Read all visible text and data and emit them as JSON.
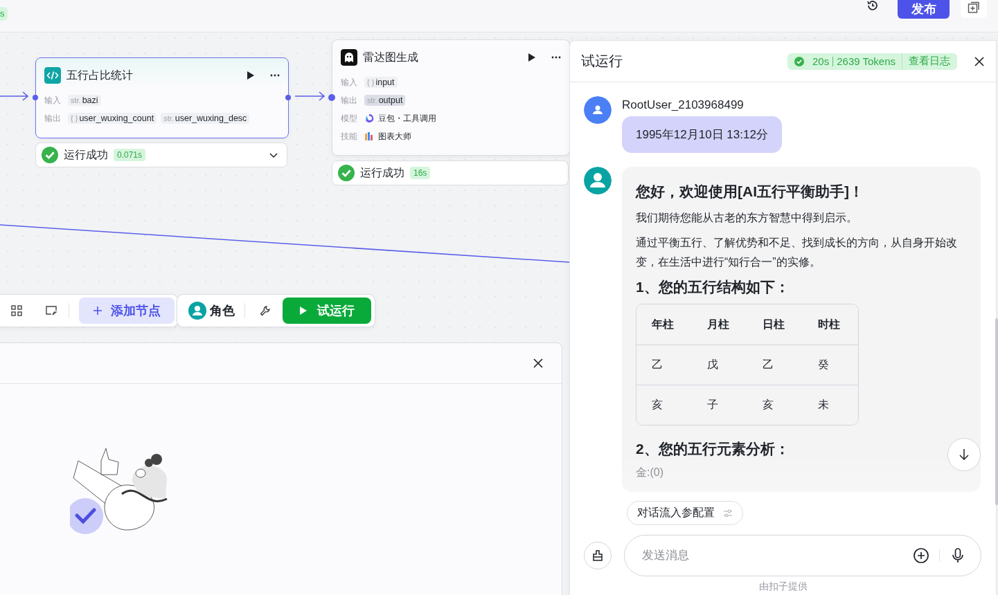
{
  "top_bar": {
    "badge": "s",
    "publish_button": "发布"
  },
  "nodes": [
    {
      "kind": "code",
      "title": "五行占比统计",
      "selected": true,
      "fields": [
        {
          "kind": "params",
          "label": "输入",
          "params": [
            {
              "type": "str.",
              "name": "bazi",
              "highlighted": false
            }
          ]
        },
        {
          "kind": "params",
          "label": "输出",
          "params": [
            {
              "type": "{ }",
              "name": "user_wuxing_count",
              "highlighted": false
            },
            {
              "type": "str.",
              "name": "user_wuxing_desc",
              "highlighted": false
            }
          ]
        }
      ],
      "status": {
        "text": "运行成功",
        "time": "0.071s"
      }
    },
    {
      "kind": "llm",
      "title": "雷达图生成",
      "selected": false,
      "fields": [
        {
          "kind": "params",
          "label": "输入",
          "params": [
            {
              "type": "{ }",
              "name": "input",
              "highlighted": false
            }
          ]
        },
        {
          "kind": "params",
          "label": "输出",
          "params": [
            {
              "type": "str.",
              "name": "output",
              "highlighted": true
            }
          ]
        },
        {
          "kind": "model",
          "label": "模型",
          "value": "豆包・工具调用"
        },
        {
          "kind": "skill",
          "label": "技能",
          "value": "图表大师"
        }
      ],
      "status": {
        "text": "运行成功",
        "time": "16s"
      }
    }
  ],
  "toolbar": {
    "add_node": "添加节点",
    "role": "角色",
    "test_run": "试运行"
  },
  "test_run_panel": {
    "title": "试运行",
    "status": {
      "duration": "20s",
      "tokens": "2639 Tokens",
      "log_link": "查看日志"
    },
    "messages": [
      {
        "kind": "user",
        "name": "RootUser_2103968499",
        "text": "1995年12月10日 13:12分"
      },
      {
        "kind": "bot",
        "blocks": [
          {
            "kind": "title",
            "text": "您好，欢迎使用[AI五行平衡助手]！"
          },
          {
            "kind": "paragraph",
            "text": "我们期待您能从古老的东方智慧中得到启示。"
          },
          {
            "kind": "paragraph",
            "text": "通过平衡五行、了解优势和不足、找到成长的方向，从自身开始改变，在生活中进行“知行合一”的实修。"
          },
          {
            "kind": "heading",
            "text": "1、您的五行结构如下："
          },
          {
            "kind": "table",
            "columns": [
              "年柱",
              "月柱",
              "日柱",
              "时柱"
            ],
            "rows": [
              [
                "乙",
                "戊",
                "乙",
                "癸"
              ],
              [
                "亥",
                "子",
                "亥",
                "未"
              ]
            ]
          },
          {
            "kind": "heading",
            "text": "2、您的五行元素分析："
          },
          {
            "kind": "faded",
            "text": "金:(0)"
          }
        ]
      }
    ],
    "config_chip": "对话流入参配置",
    "input": {
      "placeholder": "发送消息"
    },
    "footer": "由扣子提供"
  }
}
